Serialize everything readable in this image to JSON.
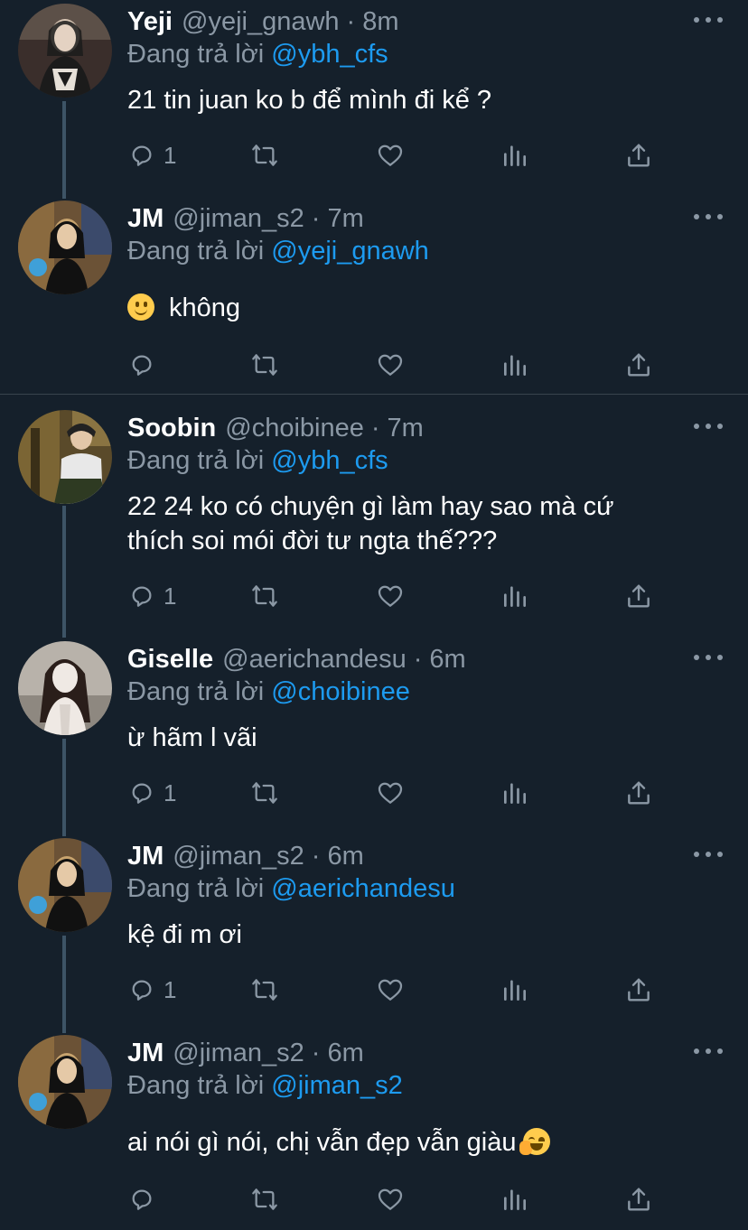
{
  "reply_prefix": "Đang trả lời",
  "tweets": [
    {
      "name": "Yeji",
      "handle": "@yeji_gnawh",
      "time": "8m",
      "reply_to": "@ybh_cfs",
      "lines": [
        "21 tin juan ko b để mình đi kể ?"
      ],
      "reply_count": "1",
      "avatar_colors": [
        "#3a2e2b",
        "#d8c6b5",
        "#1b1b1b"
      ]
    },
    {
      "name": "JM",
      "handle": "@jiman_s2",
      "time": "7m",
      "reply_to": "@yeji_gnawh",
      "text": "không",
      "reply_count": "",
      "avatar_colors": [
        "#6b5236",
        "#c8a46e",
        "#111111"
      ]
    },
    {
      "name": "Soobin",
      "handle": "@choibinee",
      "time": "7m",
      "reply_to": "@ybh_cfs",
      "lines": [
        "22 24 ko có chuyện gì làm hay sao mà cứ",
        "thích soi mói đời tư ngta thế???"
      ],
      "reply_count": "1",
      "avatar_colors": [
        "#5a4a2a",
        "#e8e8e8",
        "#2e3a22"
      ]
    },
    {
      "name": "Giselle",
      "handle": "@aerichandesu",
      "time": "6m",
      "reply_to": "@choibinee",
      "lines": [
        "ừ hãm l vãi"
      ],
      "reply_count": "1",
      "avatar_colors": [
        "#b8b2aa",
        "#2a1e1a",
        "#efe9e4"
      ]
    },
    {
      "name": "JM",
      "handle": "@jiman_s2",
      "time": "6m",
      "reply_to": "@aerichandesu",
      "lines": [
        "kệ đi m ơi"
      ],
      "reply_count": "1",
      "avatar_colors": [
        "#6b5236",
        "#c8a46e",
        "#111111"
      ]
    },
    {
      "name": "JM",
      "handle": "@jiman_s2",
      "time": "6m",
      "reply_to": "@jiman_s2",
      "text": "ai nói gì nói, chị vẫn đẹp vẫn giàu",
      "reply_count": "",
      "avatar_colors": [
        "#6b5236",
        "#c8a46e",
        "#111111"
      ]
    }
  ],
  "icons": {
    "reply": "reply-icon",
    "retweet": "retweet-icon",
    "like": "heart-icon",
    "analytics": "analytics-icon",
    "share": "share-icon",
    "more": "more-icon"
  },
  "colors": {
    "background": "#15202b",
    "text": "#ffffff",
    "secondary": "#8b98a5",
    "link": "#1d9bf0",
    "thread_line": "#3d5466",
    "divider": "#38444d"
  }
}
